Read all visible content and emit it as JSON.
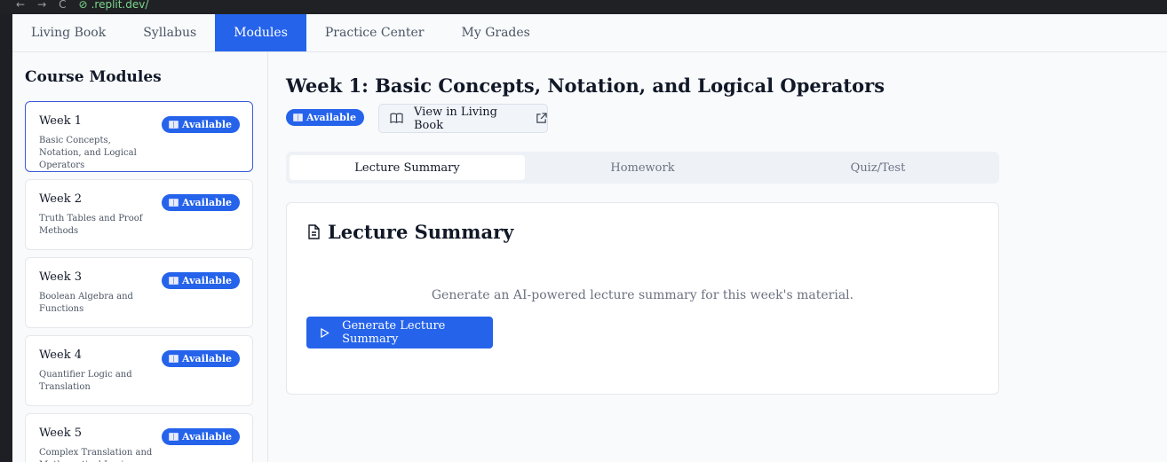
{
  "browser": {
    "url": ".replit.dev/"
  },
  "nav": {
    "tabs": [
      {
        "label": "Living Book"
      },
      {
        "label": "Syllabus"
      },
      {
        "label": "Modules"
      },
      {
        "label": "Practice Center"
      },
      {
        "label": "My Grades"
      }
    ],
    "active": "Modules"
  },
  "sidebar": {
    "heading": "Course Modules",
    "modules": [
      {
        "week": "Week 1",
        "desc": "Basic Concepts, Notation, and Logical Operators",
        "badge": "Available"
      },
      {
        "week": "Week 2",
        "desc": "Truth Tables and Proof Methods",
        "badge": "Available"
      },
      {
        "week": "Week 3",
        "desc": "Boolean Algebra and Functions",
        "badge": "Available"
      },
      {
        "week": "Week 4",
        "desc": "Quantifier Logic and Translation",
        "badge": "Available"
      },
      {
        "week": "Week 5",
        "desc": "Complex Translation and Mathematical Logic",
        "badge": "Available"
      }
    ]
  },
  "main": {
    "title": "Week 1: Basic Concepts, Notation, and Logical Operators",
    "status_badge": "Available",
    "living_book_button": "View in Living Book",
    "tabs": [
      {
        "label": "Lecture Summary"
      },
      {
        "label": "Homework"
      },
      {
        "label": "Quiz/Test"
      }
    ],
    "panel": {
      "heading": "Lecture Summary",
      "message": "Generate an AI-powered lecture summary for this week's material.",
      "button": "Generate Lecture Summary"
    }
  },
  "colors": {
    "accent": "#2563eb",
    "background": "#f8fafc",
    "border": "#e5e7eb",
    "muted_text": "#6b7280"
  }
}
